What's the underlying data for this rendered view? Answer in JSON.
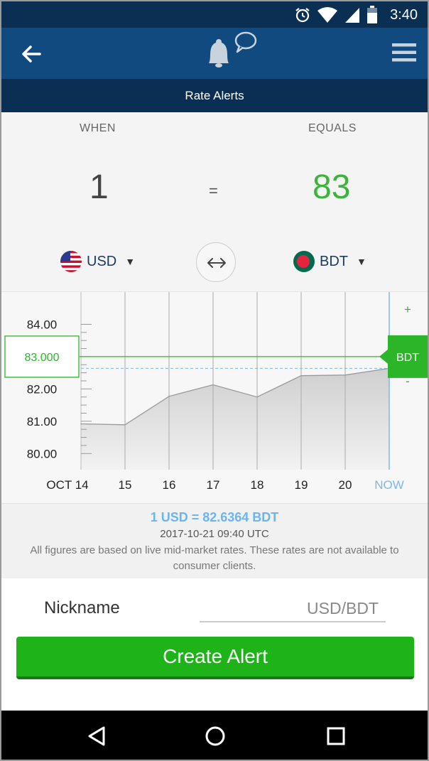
{
  "status": {
    "time": "3:40"
  },
  "header": {
    "title": "Rate Alerts"
  },
  "converter": {
    "when_label": "WHEN",
    "equals_label": "EQUALS",
    "from_amount": "1",
    "equals_sign": "=",
    "to_amount": "83",
    "from_currency": "USD",
    "to_currency": "BDT",
    "caret": "▼"
  },
  "chart": {
    "target_label": "83.000",
    "currency_tag": "BDT",
    "plus": "+",
    "minus": "-",
    "y_ticks": [
      "84.00",
      "83.00",
      "82.00",
      "81.00",
      "80.00"
    ],
    "x_ticks": [
      "OCT 14",
      "15",
      "16",
      "17",
      "18",
      "19",
      "20",
      "NOW"
    ]
  },
  "chart_data": {
    "type": "area",
    "categories": [
      "OCT 14",
      "15",
      "16",
      "17",
      "18",
      "19",
      "20",
      "NOW"
    ],
    "series": [
      {
        "values": [
          80.92,
          80.89,
          81.77,
          82.13,
          81.75,
          82.41,
          82.43,
          82.6364
        ]
      }
    ],
    "ylim": [
      79.5,
      85.0
    ],
    "target": 83.0,
    "current": 82.6364,
    "grid": true
  },
  "info": {
    "rate": "1 USD = 82.6364 BDT",
    "timestamp": "2017-10-21 09:40 UTC",
    "disclaimer": "All figures are based on live mid-market rates. These rates are not available to consumer clients."
  },
  "form": {
    "nickname_label": "Nickname",
    "nickname_placeholder": "USD/BDT",
    "create_label": "Create Alert"
  },
  "colors": {
    "appbar": "#114a7e",
    "dark_bar": "#0a2f52",
    "accent_green": "#2db52a",
    "rate_blue": "#6ab5f2"
  },
  "icons": [
    "back-arrow-icon",
    "bell-icon",
    "chat-bubble-icon",
    "menu-icon",
    "swap-icon",
    "usa-flag-icon",
    "bangladesh-flag-icon",
    "nav-back-icon",
    "nav-home-icon",
    "nav-recents-icon",
    "alarm-icon",
    "wifi-icon",
    "signal-icon",
    "battery-icon"
  ]
}
